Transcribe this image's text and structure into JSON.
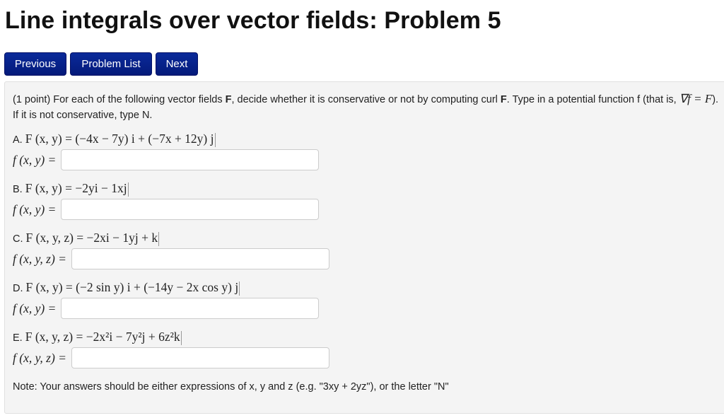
{
  "page": {
    "title": "Line integrals over vector fields: Problem 5"
  },
  "nav": {
    "previous_label": "Previous",
    "problem_list_label": "Problem List",
    "next_label": "Next"
  },
  "problem": {
    "points": "(1 point)",
    "intro_part1": "For each of the following vector fields",
    "bold_F": "F",
    "intro_part2": ", decide whether it is conservative or not by computing curl",
    "intro_part3": ". Type in a potential function f (that is,",
    "grad_expr": "∇f = F",
    "intro_part4": "). If it is not conservative, type N.",
    "parts": [
      {
        "letter": "A.",
        "field": "F (x, y) = (−4x − 7y) i + (−7x + 12y) j",
        "answer_label": "f (x, y) =",
        "answer_value": ""
      },
      {
        "letter": "B.",
        "field": "F (x, y) = −2yi − 1xj",
        "answer_label": "f (x, y) =",
        "answer_value": ""
      },
      {
        "letter": "C.",
        "field": "F (x, y, z) = −2xi − 1yj + k",
        "answer_label": "f (x, y, z) =",
        "answer_value": ""
      },
      {
        "letter": "D.",
        "field": "F (x, y) = (−2 sin y) i + (−14y − 2x cos y) j",
        "answer_label": "f (x, y) =",
        "answer_value": ""
      },
      {
        "letter": "E.",
        "field": "F (x, y, z) = −2x²i − 7y²j + 6z²k",
        "answer_label": "f (x, y, z) =",
        "answer_value": ""
      }
    ],
    "note": "Note: Your answers should be either expressions of x, y and z (e.g. \"3xy + 2yz\"), or the letter \"N\""
  }
}
